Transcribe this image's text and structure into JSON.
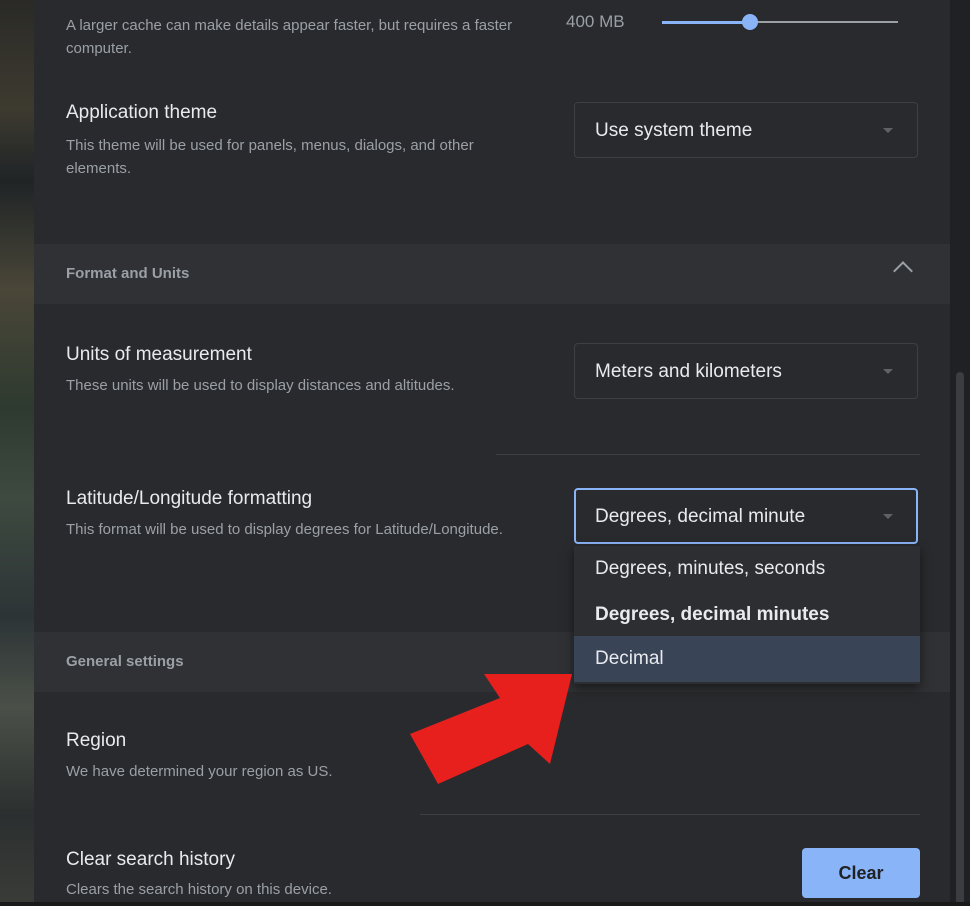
{
  "cache": {
    "description": "A larger cache can make details appear faster, but requires a faster computer.",
    "value_label": "400 MB",
    "slider_fraction": 0.37
  },
  "theme": {
    "title": "Application theme",
    "description": "This theme will be used for panels, menus, dialogs, and other elements.",
    "selected": "Use system theme"
  },
  "format_units": {
    "section_label": "Format and Units",
    "units": {
      "title": "Units of measurement",
      "description": "These units will be used to display distances and altitudes.",
      "selected": "Meters and kilometers"
    },
    "latlng": {
      "title": "Latitude/Longitude formatting",
      "description": "This format will be used to display degrees for Latitude/Longitude.",
      "selected": "Degrees, decimal minute",
      "options": [
        "Degrees, minutes, seconds",
        "Degrees, decimal minutes",
        "Decimal"
      ],
      "selected_option_index": 1,
      "hovered_option_index": 2
    }
  },
  "general": {
    "section_label": "General settings",
    "region": {
      "title": "Region",
      "description": "We have determined your region as US."
    },
    "clear_history": {
      "title": "Clear search history",
      "description": "Clears the search history on this device.",
      "button_label": "Clear"
    }
  },
  "colors": {
    "accent": "#8ab4f8",
    "background": "#292a2d",
    "section_background": "#303134",
    "annotation_arrow": "#e8201d"
  },
  "icons": {
    "collapse": "chevron-up-icon",
    "dropdown": "triangle-down-icon"
  }
}
